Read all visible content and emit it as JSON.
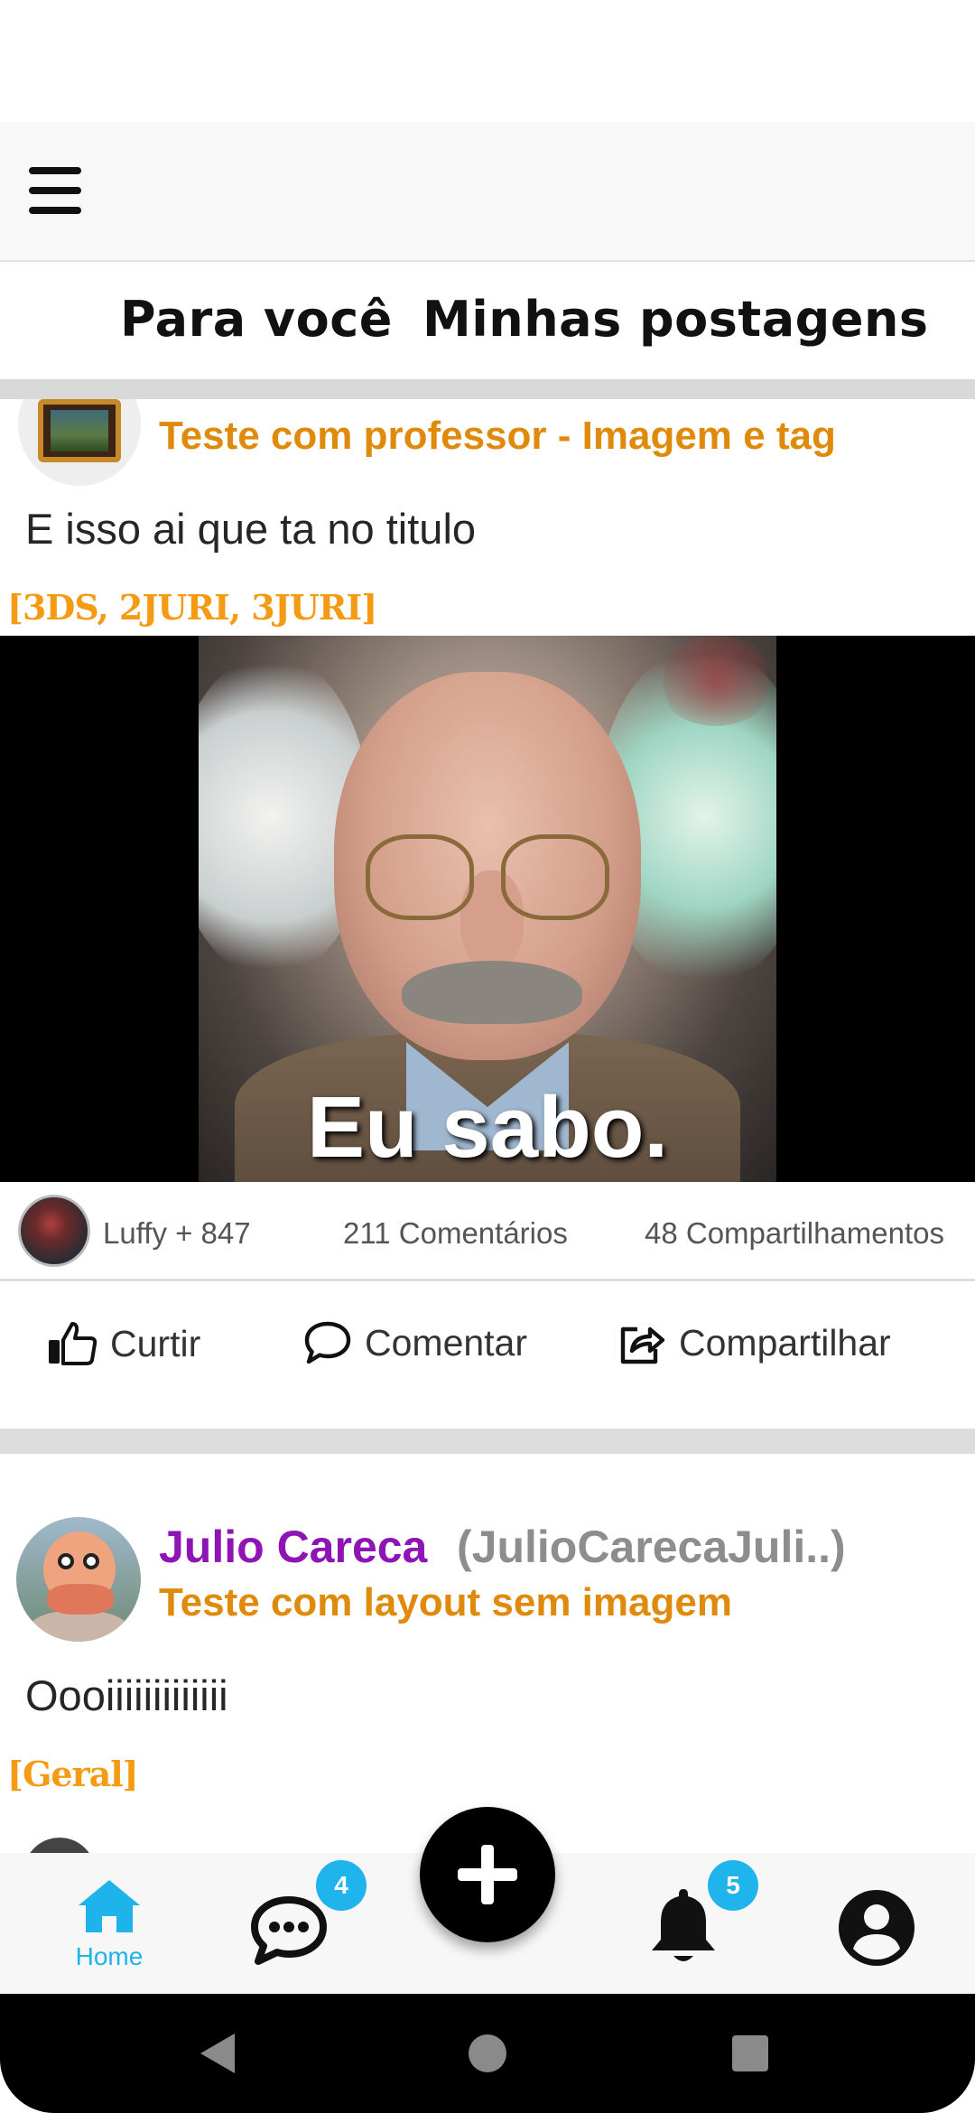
{
  "tabs": {
    "for_you": "Para você",
    "my_posts": "Minhas postagens"
  },
  "post1": {
    "title": "Teste com professor - Imagem e tag",
    "body": "E isso ai que ta no titulo",
    "tags": "[3DS, 2JURI, 3JURI]",
    "image_caption": "Eu sabo.",
    "likes": "Luffy + 847",
    "comments": "211 Comentários",
    "shares": "48 Compartilhamentos"
  },
  "actions": {
    "like": "Curtir",
    "comment": "Comentar",
    "share": "Compartilhar"
  },
  "post2": {
    "author": "Julio Careca",
    "handle": "(JulioCarecaJuli..)",
    "title": "Teste com layout sem imagem",
    "body": "Oooiiiiiiiiiiiii",
    "tags": "[Geral]"
  },
  "bottom_nav": {
    "home_label": "Home",
    "chat_badge": "4",
    "notifications_badge": "5"
  },
  "colors": {
    "title_orange": "#e08a0b",
    "tag_orange": "#f49b13",
    "author_purple": "#8e14b6",
    "accent_blue": "#1fb3ec"
  },
  "icons": {
    "menu": "hamburger-icon",
    "like": "thumbs-up-icon",
    "comment": "speech-bubble-icon",
    "share": "share-arrow-icon",
    "home": "home-icon",
    "chat": "chat-icon",
    "add": "plus-icon",
    "notifications": "bell-icon",
    "profile": "account-circle-icon"
  }
}
